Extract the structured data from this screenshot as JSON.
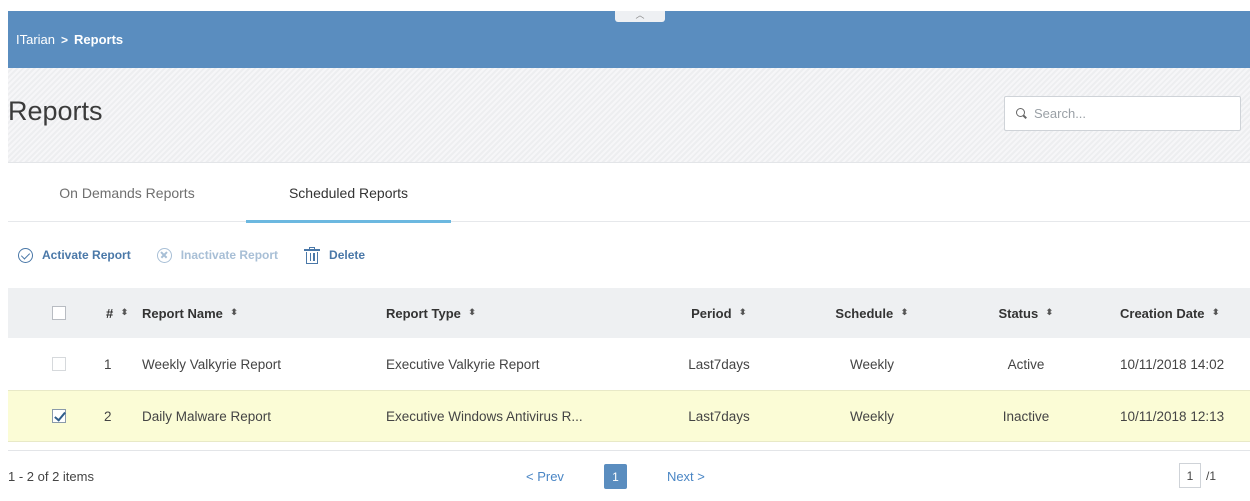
{
  "breadcrumb": {
    "root": "ITarian",
    "separator": ">",
    "current": "Reports"
  },
  "collapse_icon": "chevron-up-icon",
  "page": {
    "title": "Reports"
  },
  "search": {
    "placeholder": "Search...",
    "icon": "search-icon"
  },
  "tabs": [
    {
      "label": "On Demands Reports",
      "active": false
    },
    {
      "label": "Scheduled Reports",
      "active": true
    }
  ],
  "toolbar": {
    "activate_label": "Activate Report",
    "inactivate_label": "Inactivate Report",
    "delete_label": "Delete"
  },
  "table": {
    "columns": [
      {
        "label": "#"
      },
      {
        "label": "Report Name"
      },
      {
        "label": "Report Type"
      },
      {
        "label": "Period"
      },
      {
        "label": "Schedule"
      },
      {
        "label": "Status"
      },
      {
        "label": "Creation Date"
      }
    ],
    "rows": [
      {
        "num": "1",
        "name": "Weekly Valkyrie Report",
        "type": "Executive Valkyrie Report",
        "period": "Last7days",
        "schedule": "Weekly",
        "status": "Active",
        "date": "10/11/2018 14:02",
        "checked": false
      },
      {
        "num": "2",
        "name": "Daily Malware Report",
        "type": "Executive Windows Antivirus R...",
        "period": "Last7days",
        "schedule": "Weekly",
        "status": "Inactive",
        "date": "10/11/2018 12:13",
        "checked": true
      }
    ]
  },
  "footer": {
    "items_text": "1 - 2 of 2 items",
    "prev_label": "< Prev",
    "next_label": "Next >",
    "current_page": "1",
    "page_input": "1",
    "total_pages": "/1"
  },
  "colors": {
    "topbar": "#5a8dbf",
    "accent": "#6cb8e0",
    "link": "#4a86c5",
    "selected_row": "#fbfcd6"
  }
}
